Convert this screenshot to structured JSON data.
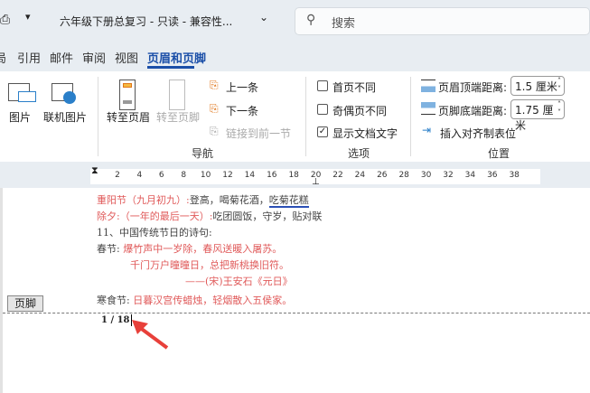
{
  "titlebar": {
    "doc_title": "六年级下册总复习  -  只读  -  兼容性...",
    "search_placeholder": "搜索"
  },
  "tabs": [
    {
      "label": "局"
    },
    {
      "label": "引用"
    },
    {
      "label": "邮件"
    },
    {
      "label": "审阅"
    },
    {
      "label": "视图"
    },
    {
      "label": "页眉和页脚",
      "active": true
    }
  ],
  "ribbon": {
    "insert": {
      "picture": "图片",
      "online_picture": "联机图片"
    },
    "nav": {
      "goto_header": "转至页眉",
      "goto_footer": "转至页脚",
      "previous": "上一条",
      "next": "下一条",
      "link_previous": "链接到前一节",
      "group": "导航"
    },
    "options": {
      "first_page": "首页不同",
      "odd_even": "奇偶页不同",
      "show_doc_text": "显示文档文字",
      "group": "选项",
      "checked": [
        false,
        false,
        true
      ]
    },
    "position": {
      "header_top_label": "页眉顶端距离:",
      "header_top_value": "1.5 厘米",
      "footer_bottom_label": "页脚底端距离:",
      "footer_bottom_value": "1.75 厘米",
      "insert_tab": "插入对齐制表位",
      "group": "位置"
    }
  },
  "ruler": {
    "ticks": [
      "2",
      "4",
      "6",
      "8",
      "10",
      "12",
      "14",
      "16",
      "18",
      "20",
      "22",
      "24",
      "26",
      "28",
      "30",
      "32",
      "34",
      "36",
      "38"
    ]
  },
  "document": {
    "lines": [
      {
        "a": "重阳节（九月初九）:",
        "b": "登高，喝菊花酒，",
        "c": "吃菊花糕"
      },
      {
        "a": "除夕:（一年的最后一天）:",
        "b": "吃团圆饭，守岁，贴对联"
      },
      {
        "b": "11、中国传统节日的诗句:"
      },
      {
        "b": "春节: ",
        "a": "爆竹声中一岁除，春风送暖入屠苏。"
      },
      {
        "a": "千门万户曈曈日，总把新桃换旧符。"
      },
      {
        "a": "——(宋)王安石《元日》"
      },
      {
        "b": "寒食节: ",
        "a": "日暮汉宫传蜡烛，轻烟散入五侯家。"
      }
    ],
    "footer_label": "页脚",
    "page_number": "1 / 18"
  },
  "colors": {
    "accent": "#1b4fa8",
    "poem": "#e05a5a",
    "arrow": "#e8403a"
  }
}
